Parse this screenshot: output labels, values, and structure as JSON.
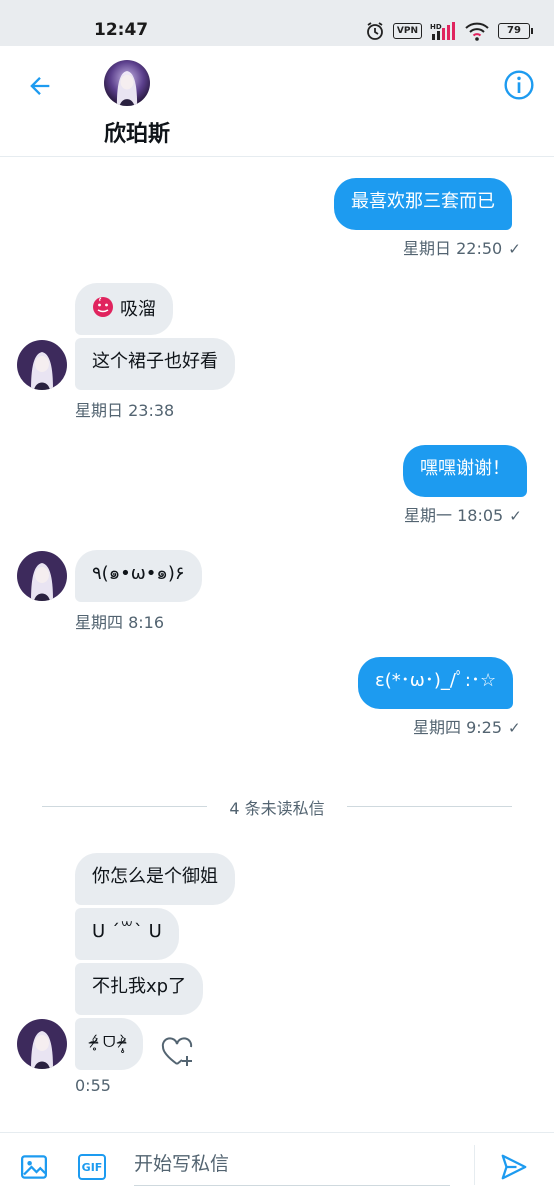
{
  "status_bar": {
    "time": "12:47",
    "vpn_label": "VPN",
    "battery": "79",
    "icons": [
      "alarm-icon",
      "vpn-icon",
      "signal-hd-icon",
      "wifi-icon",
      "battery-icon"
    ]
  },
  "header": {
    "contact_name": "欣珀斯",
    "back_icon": "arrow-left-icon",
    "info_icon": "info-icon"
  },
  "messages": [
    {
      "dir": "out",
      "text": "最喜欢那三套而已"
    },
    {
      "dir": "out",
      "meta": "星期日 22:50",
      "read": true
    },
    {
      "dir": "in",
      "text": "吸溜",
      "emoji": "drooling-face-icon"
    },
    {
      "dir": "in",
      "text": "这个裙子也好看"
    },
    {
      "dir": "in",
      "meta": "星期日 23:38"
    },
    {
      "dir": "out",
      "text": "嘿嘿谢谢！"
    },
    {
      "dir": "out",
      "meta": "星期一 18:05",
      "read": true
    },
    {
      "dir": "in",
      "text": "٩(๑•ω•๑)۶"
    },
    {
      "dir": "in",
      "meta": "星期四 8:16"
    },
    {
      "dir": "out",
      "text": "ε(*･ω･)_/ﾟ:･☆"
    },
    {
      "dir": "out",
      "meta": "星期四 9:25",
      "read": true
    },
    {
      "dir": "in",
      "text": "你怎么是个御姐"
    },
    {
      "dir": "in",
      "text": "U ´꒳` U"
    },
    {
      "dir": "in",
      "text": "不扎我xp了"
    },
    {
      "dir": "in",
      "text": "ᵒ̴̶̷̥́ ᗜ ᵒ̴̶̷̣̥̀"
    },
    {
      "dir": "in",
      "meta": "0:55"
    }
  ],
  "unread_divider": "4 条未读私信",
  "composer": {
    "placeholder": "开始写私信",
    "image_icon": "image-icon",
    "gif_label": "GIF",
    "send_icon": "send-icon"
  },
  "colors": {
    "accent": "#1d9bf0",
    "incoming_bubble": "#e8ecf0",
    "meta_text": "#536471"
  }
}
